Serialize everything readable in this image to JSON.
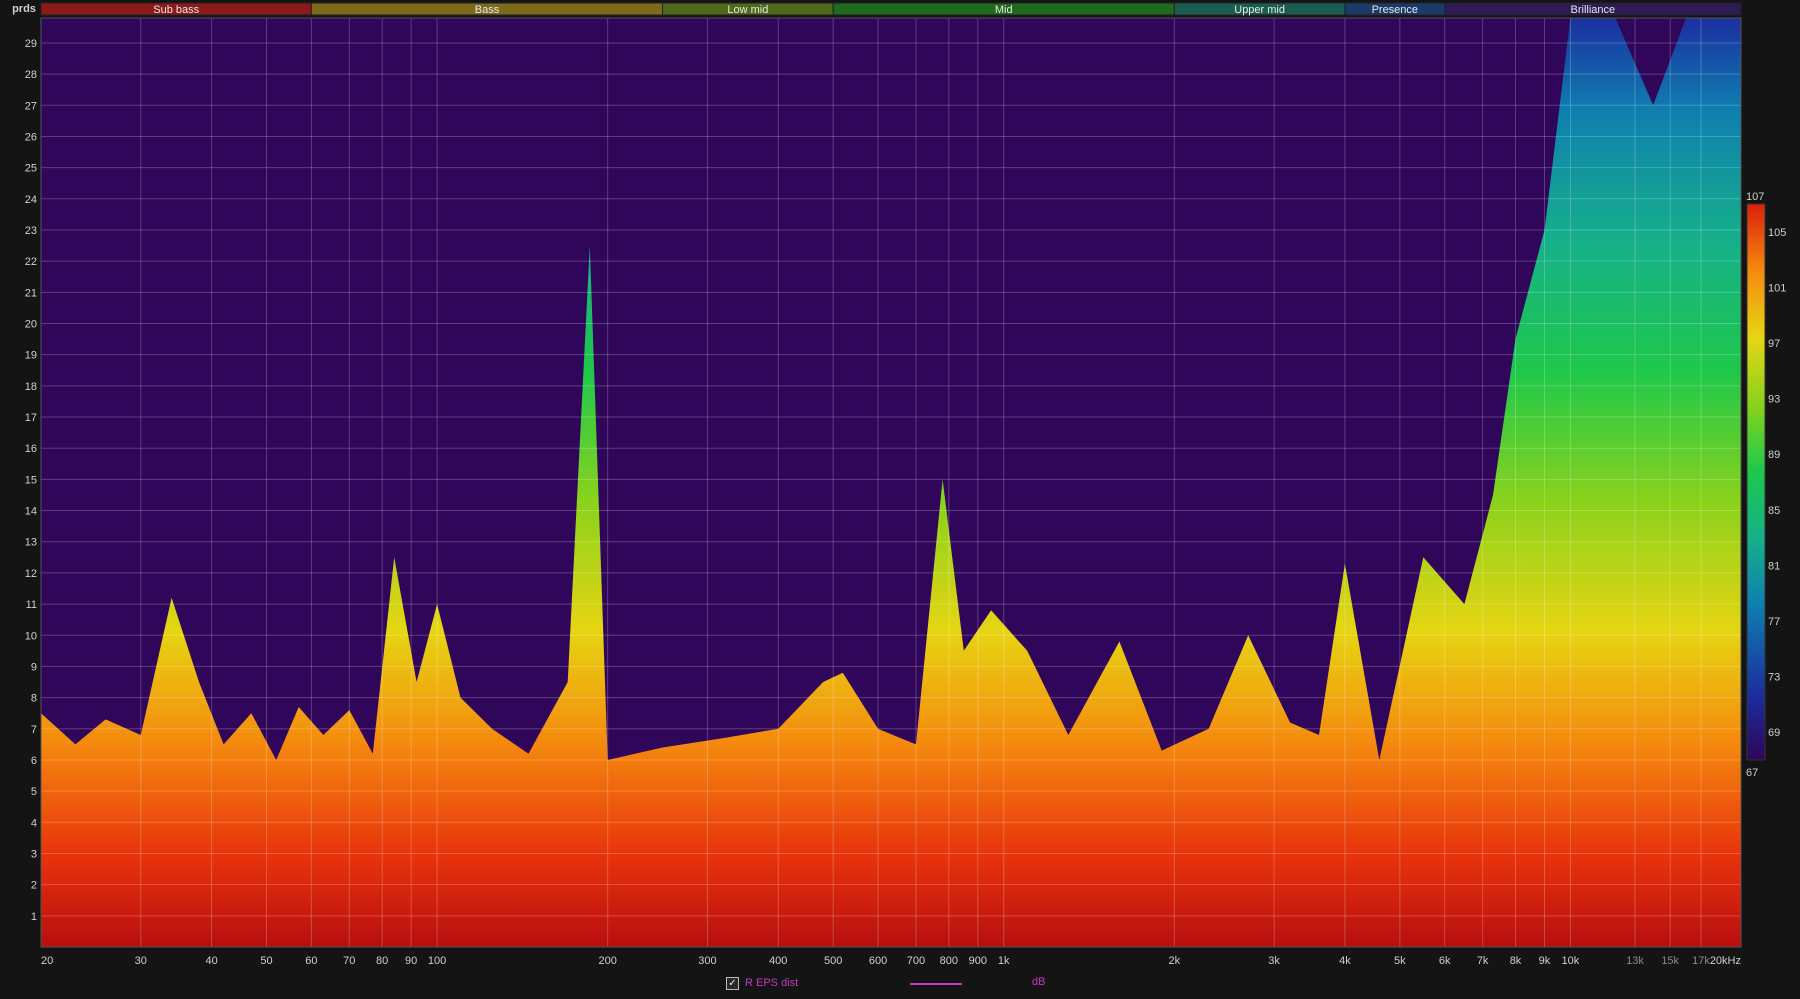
{
  "chart_data": {
    "type": "heatmap",
    "title": "",
    "xlabel": "",
    "ylabel": "prds",
    "x_scale": "log",
    "x_range_hz": [
      20,
      20000
    ],
    "y_range_periods": [
      0,
      29.8
    ],
    "x_ticks": [
      {
        "value": 20,
        "label": "20"
      },
      {
        "value": 30,
        "label": "30"
      },
      {
        "value": 40,
        "label": "40"
      },
      {
        "value": 50,
        "label": "50"
      },
      {
        "value": 60,
        "label": "60"
      },
      {
        "value": 70,
        "label": "70"
      },
      {
        "value": 80,
        "label": "80"
      },
      {
        "value": 90,
        "label": "90"
      },
      {
        "value": 100,
        "label": "100"
      },
      {
        "value": 200,
        "label": "200"
      },
      {
        "value": 300,
        "label": "300"
      },
      {
        "value": 400,
        "label": "400"
      },
      {
        "value": 500,
        "label": "500"
      },
      {
        "value": 600,
        "label": "600"
      },
      {
        "value": 700,
        "label": "700"
      },
      {
        "value": 800,
        "label": "800"
      },
      {
        "value": 900,
        "label": "900"
      },
      {
        "value": 1000,
        "label": "1k"
      },
      {
        "value": 2000,
        "label": "2k"
      },
      {
        "value": 3000,
        "label": "3k"
      },
      {
        "value": 4000,
        "label": "4k"
      },
      {
        "value": 5000,
        "label": "5k"
      },
      {
        "value": 6000,
        "label": "6k"
      },
      {
        "value": 7000,
        "label": "7k"
      },
      {
        "value": 8000,
        "label": "8k"
      },
      {
        "value": 9000,
        "label": "9k"
      },
      {
        "value": 10000,
        "label": "10k"
      },
      {
        "value": 13000,
        "label": "13k",
        "dim": true
      },
      {
        "value": 15000,
        "label": "15k",
        "dim": true
      },
      {
        "value": 17000,
        "label": "17k",
        "dim": true
      },
      {
        "value": 20000,
        "label": "20kHz"
      }
    ],
    "y_ticks": [
      1,
      2,
      3,
      4,
      5,
      6,
      7,
      8,
      9,
      10,
      11,
      12,
      13,
      14,
      15,
      16,
      17,
      18,
      19,
      20,
      21,
      22,
      23,
      24,
      25,
      26,
      27,
      28,
      29
    ],
    "bands": [
      {
        "name": "Sub bass",
        "from": 20,
        "to": 60,
        "color": "#8b1a1a"
      },
      {
        "name": "Bass",
        "from": 60,
        "to": 250,
        "color": "#7d6a1a"
      },
      {
        "name": "Low mid",
        "from": 250,
        "to": 500,
        "color": "#4e6a1a"
      },
      {
        "name": "Mid",
        "from": 500,
        "to": 2000,
        "color": "#1f6a1f"
      },
      {
        "name": "Upper mid",
        "from": 2000,
        "to": 4000,
        "color": "#1a5e52"
      },
      {
        "name": "Presence",
        "from": 4000,
        "to": 6000,
        "color": "#1a3a6a"
      },
      {
        "name": "Brilliance",
        "from": 6000,
        "to": 20000,
        "color": "#2e1a55"
      }
    ],
    "colorbar": {
      "min": 67,
      "max": 107,
      "unit": "dB",
      "tick_labels": [
        107,
        105,
        101,
        97,
        93,
        89,
        85,
        81,
        77,
        73,
        69,
        67
      ],
      "colors": [
        "#30065a",
        "#1b2fa0",
        "#0f7fb0",
        "#16b08a",
        "#1ec84a",
        "#8ad21c",
        "#e6d512",
        "#f58a0e",
        "#e8340c",
        "#c40e0e"
      ]
    },
    "decay_profile": [
      {
        "freq": 20,
        "periods": 7.5
      },
      {
        "freq": 23,
        "periods": 6.5
      },
      {
        "freq": 26,
        "periods": 7.3
      },
      {
        "freq": 30,
        "periods": 6.8
      },
      {
        "freq": 34,
        "periods": 11.2
      },
      {
        "freq": 38,
        "periods": 8.5
      },
      {
        "freq": 42,
        "periods": 6.5
      },
      {
        "freq": 47,
        "periods": 7.5
      },
      {
        "freq": 52,
        "periods": 6.0
      },
      {
        "freq": 57,
        "periods": 7.7
      },
      {
        "freq": 63,
        "periods": 6.8
      },
      {
        "freq": 70,
        "periods": 7.6
      },
      {
        "freq": 77,
        "periods": 6.2
      },
      {
        "freq": 84,
        "periods": 12.5
      },
      {
        "freq": 92,
        "periods": 8.5
      },
      {
        "freq": 100,
        "periods": 11.0
      },
      {
        "freq": 110,
        "periods": 8.0
      },
      {
        "freq": 125,
        "periods": 7.0
      },
      {
        "freq": 145,
        "periods": 6.2
      },
      {
        "freq": 170,
        "periods": 8.5
      },
      {
        "freq": 186,
        "periods": 22.5
      },
      {
        "freq": 200,
        "periods": 6.0
      },
      {
        "freq": 250,
        "periods": 6.4
      },
      {
        "freq": 320,
        "periods": 6.7
      },
      {
        "freq": 400,
        "periods": 7.0
      },
      {
        "freq": 480,
        "periods": 8.5
      },
      {
        "freq": 520,
        "periods": 8.8
      },
      {
        "freq": 600,
        "periods": 7.0
      },
      {
        "freq": 700,
        "periods": 6.5
      },
      {
        "freq": 780,
        "periods": 15.0
      },
      {
        "freq": 850,
        "periods": 9.5
      },
      {
        "freq": 950,
        "periods": 10.8
      },
      {
        "freq": 1100,
        "periods": 9.5
      },
      {
        "freq": 1300,
        "periods": 6.8
      },
      {
        "freq": 1600,
        "periods": 9.8
      },
      {
        "freq": 1900,
        "periods": 6.3
      },
      {
        "freq": 2300,
        "periods": 7.0
      },
      {
        "freq": 2700,
        "periods": 10.0
      },
      {
        "freq": 3200,
        "periods": 7.2
      },
      {
        "freq": 3600,
        "periods": 6.8
      },
      {
        "freq": 4000,
        "periods": 12.3
      },
      {
        "freq": 4600,
        "periods": 6.0
      },
      {
        "freq": 5500,
        "periods": 12.5
      },
      {
        "freq": 6500,
        "periods": 11.0
      },
      {
        "freq": 7300,
        "periods": 14.5
      },
      {
        "freq": 8000,
        "periods": 19.5
      },
      {
        "freq": 9000,
        "periods": 23.0
      },
      {
        "freq": 10000,
        "periods": 29.8
      },
      {
        "freq": 12000,
        "periods": 29.8
      },
      {
        "freq": 14000,
        "periods": 27.0
      },
      {
        "freq": 16000,
        "periods": 29.8
      },
      {
        "freq": 20000,
        "periods": 29.8
      }
    ]
  },
  "legend": {
    "series_name": "R EPS dist",
    "checked": "✓",
    "unit": "dB"
  }
}
